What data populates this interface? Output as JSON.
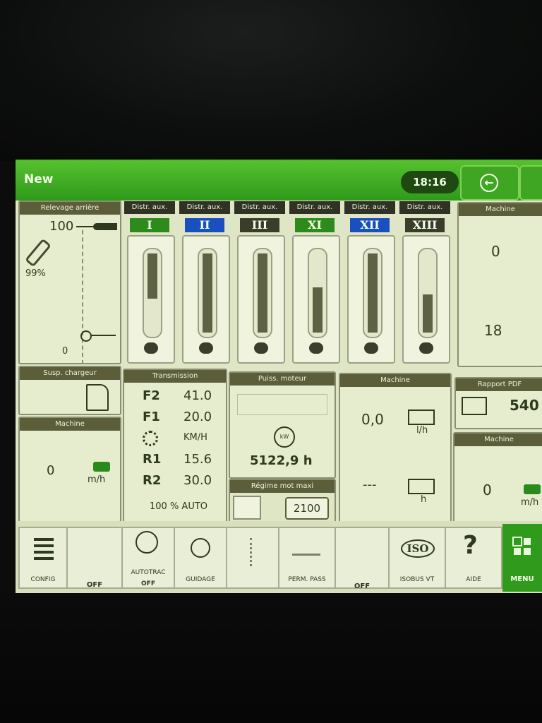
{
  "header": {
    "title": "New",
    "time": "18:16"
  },
  "rear_hitch": {
    "title": "Relevage arrière",
    "top_value": "100",
    "bottom_value": "0",
    "percent": "99%"
  },
  "aux_valves": [
    {
      "label": "Distr. aux.",
      "numeral": "I",
      "color": "#2f8a1c",
      "level": 0.55
    },
    {
      "label": "Distr. aux.",
      "numeral": "II",
      "color": "#1a4fc0",
      "level": 1.0
    },
    {
      "label": "Distr. aux.",
      "numeral": "III",
      "color": "#3a3d2a",
      "level": 0.9
    },
    {
      "label": "Distr. aux.",
      "numeral": "XI",
      "color": "#2f8a1c",
      "level": 0.55
    },
    {
      "label": "Distr. aux.",
      "numeral": "XII",
      "color": "#1a4fc0",
      "level": 0.95
    },
    {
      "label": "Distr. aux.",
      "numeral": "XIII",
      "color": "#3a3d2a",
      "level": 0.45
    }
  ],
  "machine_top": {
    "title": "Machine",
    "value1": "0",
    "value2": "18"
  },
  "loader_susp": {
    "title": "Susp. chargeur"
  },
  "machine_speed": {
    "title": "Machine",
    "value": "0",
    "unit": "m/h"
  },
  "transmission": {
    "title": "Transmission",
    "rows": [
      {
        "label": "F2",
        "value": "41.0"
      },
      {
        "label": "F1",
        "value": "20.0"
      },
      {
        "label": "",
        "value": "KM/H"
      },
      {
        "label": "R1",
        "value": "15.6"
      },
      {
        "label": "R2",
        "value": "30.0"
      }
    ],
    "auto": "100 % AUTO"
  },
  "engine_power": {
    "title": "Puiss. moteur",
    "hours": "5122,9 h",
    "kw": "kW"
  },
  "max_engine": {
    "title": "Régime mot maxi",
    "value": "2100"
  },
  "machine_fuel": {
    "title": "Machine",
    "value": "0,0",
    "unit": "l/h",
    "dashes": "---",
    "unit2": "h"
  },
  "pto": {
    "title": "Rapport PDF",
    "value": "540"
  },
  "machine_right": {
    "title": "Machine",
    "value": "0",
    "unit": "m/h"
  },
  "footer": [
    {
      "label": "CONFIG",
      "state": ""
    },
    {
      "label": "",
      "state": "OFF"
    },
    {
      "label": "AUTOTRAC",
      "state": "OFF"
    },
    {
      "label": "GUIDAGE",
      "state": ""
    },
    {
      "label": "",
      "state": ""
    },
    {
      "label": "PERM. PASS",
      "state": ""
    },
    {
      "label": "",
      "state": "OFF"
    },
    {
      "label": "ISOBUS VT",
      "state": ""
    },
    {
      "label": "AIDE",
      "state": ""
    },
    {
      "label": "MENU",
      "state": ""
    }
  ],
  "iso_text": "ISO",
  "help_text": "?"
}
